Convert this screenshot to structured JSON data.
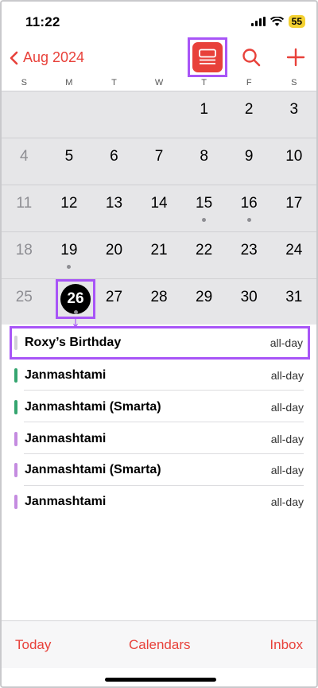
{
  "status": {
    "time": "11:22",
    "battery": "55"
  },
  "nav": {
    "month_label": "Aug 2024"
  },
  "weekdays": [
    "S",
    "M",
    "T",
    "W",
    "T",
    "F",
    "S"
  ],
  "calendar": {
    "weeks": [
      [
        "",
        "",
        "",
        "",
        "1",
        "2",
        "3"
      ],
      [
        "4",
        "5",
        "6",
        "7",
        "8",
        "9",
        "10"
      ],
      [
        "11",
        "12",
        "13",
        "14",
        "15",
        "16",
        "17"
      ],
      [
        "18",
        "19",
        "20",
        "21",
        "22",
        "23",
        "24"
      ],
      [
        "25",
        "26",
        "27",
        "28",
        "29",
        "30",
        "31"
      ]
    ],
    "today": "26"
  },
  "events": [
    {
      "title": "Roxy’s Birthday",
      "time": "all-day",
      "color": "#d1d1d6"
    },
    {
      "title": "Janmashtami",
      "time": "all-day",
      "color": "#34a56f"
    },
    {
      "title": "Janmashtami (Smarta)",
      "time": "all-day",
      "color": "#34a56f"
    },
    {
      "title": "Janmashtami",
      "time": "all-day",
      "color": "#c48be0"
    },
    {
      "title": "Janmashtami (Smarta)",
      "time": "all-day",
      "color": "#c48be0"
    },
    {
      "title": "Janmashtami",
      "time": "all-day",
      "color": "#c48be0"
    }
  ],
  "toolbar": {
    "today": "Today",
    "calendars": "Calendars",
    "inbox": "Inbox"
  },
  "colors": {
    "accent": "#e8413a",
    "highlight": "#a855f7"
  }
}
